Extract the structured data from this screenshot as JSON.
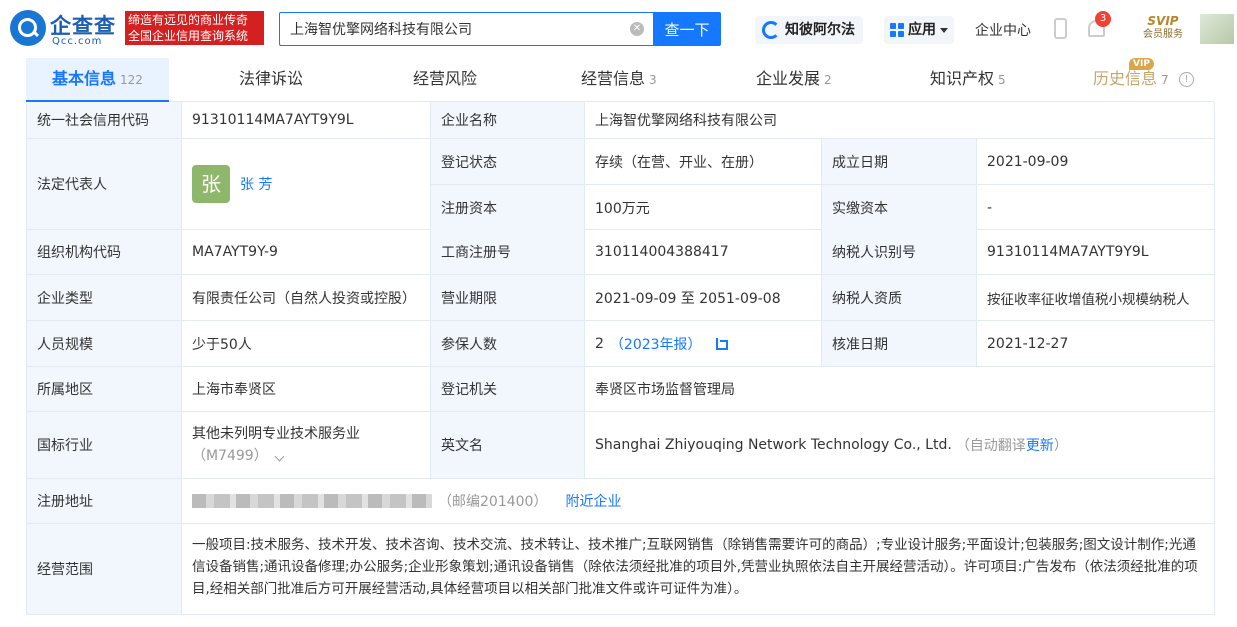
{
  "header": {
    "logo_cn": "企查查",
    "logo_en": "Qcc.com",
    "slogan_line1": "缔造有远见的商业传奇",
    "slogan_line2": "全国企业信用查询系统",
    "search_value": "上海智优擎网络科技有限公司",
    "search_button": "查一下",
    "zhibi_label": "知彼阿尔法",
    "apps_label": "应用",
    "corp_center": "企业中心",
    "notification_count": "3",
    "svip_label": "SVIP",
    "svip_sub": "会员服务"
  },
  "tabs": [
    {
      "label": "基本信息",
      "count": "122"
    },
    {
      "label": "法律诉讼",
      "count": ""
    },
    {
      "label": "经营风险",
      "count": ""
    },
    {
      "label": "经营信息",
      "count": "3"
    },
    {
      "label": "企业发展",
      "count": "2"
    },
    {
      "label": "知识产权",
      "count": "5"
    },
    {
      "label": "历史信息",
      "count": "7"
    }
  ],
  "vip_tag": "VIP",
  "info": {
    "credit_code_label": "统一社会信用代码",
    "credit_code": "91310114MA7AYT9Y9L",
    "company_name_label": "企业名称",
    "company_name": "上海智优擎网络科技有限公司",
    "legal_rep_label": "法定代表人",
    "legal_rep_avatar": "张",
    "legal_rep_name": "张 芳",
    "status_label": "登记状态",
    "status": "存续（在营、开业、在册）",
    "founded_label": "成立日期",
    "founded": "2021-09-09",
    "reg_capital_label": "注册资本",
    "reg_capital": "100万元",
    "paid_capital_label": "实缴资本",
    "paid_capital": "-",
    "org_code_label": "组织机构代码",
    "org_code": "MA7AYT9Y-9",
    "biz_reg_no_label": "工商注册号",
    "biz_reg_no": "310114004388417",
    "taxpayer_id_label": "纳税人识别号",
    "taxpayer_id": "91310114MA7AYT9Y9L",
    "company_type_label": "企业类型",
    "company_type": "有限责任公司（自然人投资或控股）",
    "term_label": "营业期限",
    "term": "2021-09-09 至 2051-09-08",
    "taxpayer_qual_label": "纳税人资质",
    "taxpayer_qual": "按征收率征收增值税小规模纳税人",
    "staff_size_label": "人员规模",
    "staff_size": "少于50人",
    "insured_label": "参保人数",
    "insured": "2",
    "insured_report": "（2023年报）",
    "approval_date_label": "核准日期",
    "approval_date": "2021-12-27",
    "region_label": "所属地区",
    "region": "上海市奉贤区",
    "authority_label": "登记机关",
    "authority": "奉贤区市场监督管理局",
    "industry_label": "国标行业",
    "industry": "其他未列明专业技术服务业",
    "industry_code": "（M7499）",
    "english_name_label": "英文名",
    "english_name": "Shanghai Zhiyouqing Network Technology Co., Ltd.",
    "auto_translate": "（自动翻译",
    "update_link": "更新",
    "auto_translate_end": "）",
    "address_label": "注册地址",
    "postcode": "（邮编201400）",
    "nearby_link": "附近企业",
    "scope_label": "经营范围",
    "scope": "一般项目:技术服务、技术开发、技术咨询、技术交流、技术转让、技术推广;互联网销售（除销售需要许可的商品）;专业设计服务;平面设计;包装服务;图文设计制作;光通信设备销售;通讯设备修理;办公服务;企业形象策划;通讯设备销售（除依法须经批准的项目外,凭营业执照依法自主开展经营活动）。许可项目:广告发布（依法须经批准的项目,经相关部门批准后方可开展经营活动,具体经营项目以相关部门批准文件或许可证件为准）。"
  }
}
